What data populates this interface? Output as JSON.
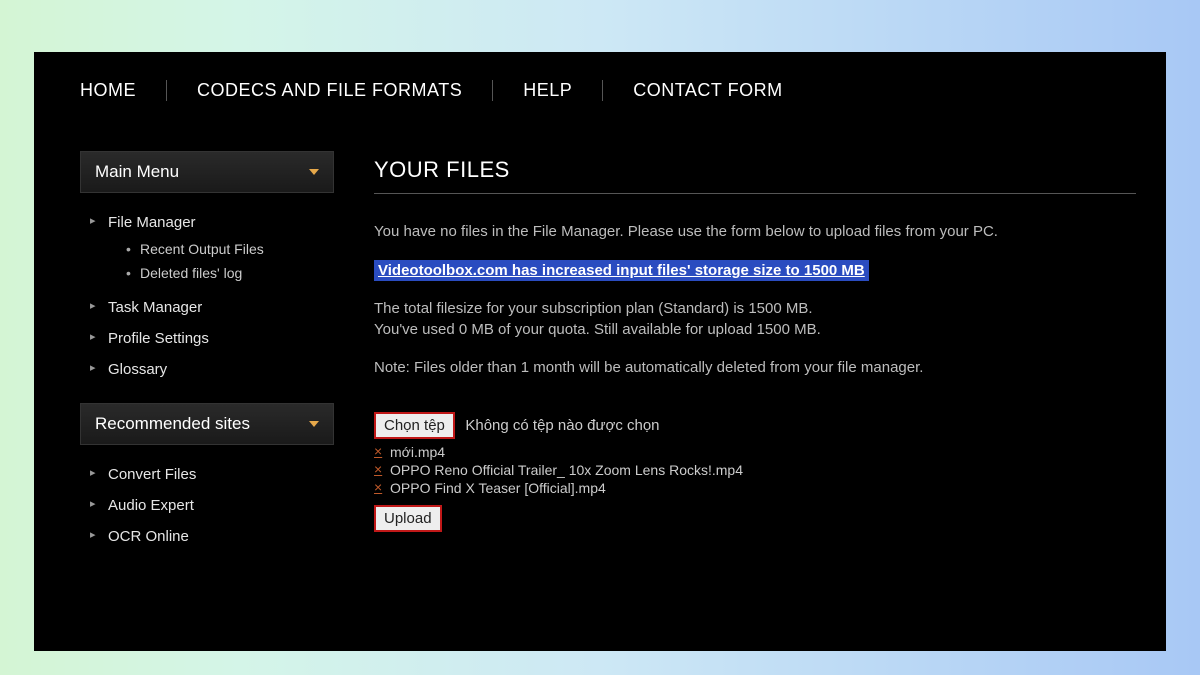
{
  "nav": {
    "home": "HOME",
    "codecs": "CODECS AND FILE FORMATS",
    "help": "HELP",
    "contact": "CONTACT FORM"
  },
  "sidebar": {
    "mainMenu": {
      "title": "Main Menu",
      "items": {
        "fileManager": "File Manager",
        "recentOutput": "Recent Output Files",
        "deletedLog": "Deleted files' log",
        "taskManager": "Task Manager",
        "profileSettings": "Profile Settings",
        "glossary": "Glossary"
      }
    },
    "recommended": {
      "title": "Recommended sites",
      "items": {
        "convertFiles": "Convert Files",
        "audioExpert": "Audio Expert",
        "ocrOnline": "OCR Online"
      }
    }
  },
  "content": {
    "title": "YOUR FILES",
    "noFiles": "You have no files in the File Manager. Please use the form below to upload files from your PC.",
    "announce": "Videotoolbox.com has increased input files' storage size to 1500 MB",
    "quota1": "The total filesize for your subscription plan (Standard) is 1500 MB.",
    "quota2": "You've used 0 MB of your quota. Still available for upload 1500 MB.",
    "note": "Note: Files older than 1 month will be automatically deleted from your file manager.",
    "chooseFile": "Chọn tệp",
    "noFileChosen": "Không có tệp nào được chọn",
    "recentFiles": [
      "mới.mp4",
      "OPPO Reno Official Trailer_ 10x Zoom Lens Rocks!.mp4",
      "OPPO Find X Teaser [Official].mp4"
    ],
    "upload": "Upload"
  }
}
